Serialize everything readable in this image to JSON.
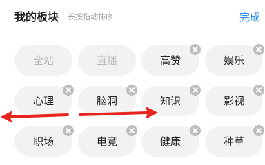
{
  "header": {
    "title": "我的板块",
    "subtitle": "长按拖动排序",
    "done_label": "完成"
  },
  "tiles": [
    {
      "label": "全站",
      "state": "disabled",
      "removable": false
    },
    {
      "label": "直播",
      "state": "disabled",
      "removable": false
    },
    {
      "label": "高赞",
      "state": "enabled",
      "removable": true
    },
    {
      "label": "娱乐",
      "state": "enabled",
      "removable": true
    },
    {
      "label": "心理",
      "state": "enabled",
      "removable": true
    },
    {
      "label": "脑洞",
      "state": "enabled",
      "removable": true
    },
    {
      "label": "知识",
      "state": "enabled",
      "removable": true
    },
    {
      "label": "影视",
      "state": "enabled",
      "removable": true
    },
    {
      "label": "职场",
      "state": "enabled",
      "removable": true
    },
    {
      "label": "电竞",
      "state": "enabled",
      "removable": true
    },
    {
      "label": "健康",
      "state": "enabled",
      "removable": true
    },
    {
      "label": "种草",
      "state": "enabled",
      "removable": true
    }
  ],
  "colors": {
    "accent": "#2b8cf2",
    "tile_bg": "#f2f2f2",
    "remove_badge": "#bdbdbd",
    "annotation_arrow": "#e8231e"
  },
  "icons": {
    "remove": "close-icon",
    "annotation": "arrow-icon"
  }
}
